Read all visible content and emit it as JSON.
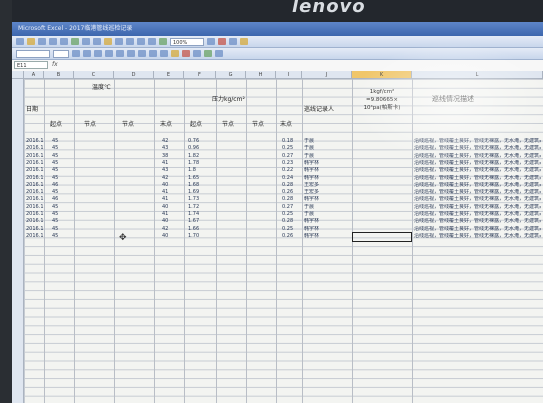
{
  "monitor": {
    "brand": "lenovo"
  },
  "window": {
    "title": "Microsoft Excel - 2017临港管线巡检记录"
  },
  "formula_bar": {
    "cell_ref": "E11",
    "fx": "fx",
    "zoom": "100%"
  },
  "columns": [
    "A",
    "B",
    "C",
    "D",
    "E",
    "F",
    "G",
    "H",
    "I",
    "J",
    "K",
    "L"
  ],
  "header": {
    "date": "日期",
    "temp_group": "温度℃",
    "pressure_group": "压力kg/cm²",
    "start1": "起点",
    "mid1": "节点",
    "mid2": "节点",
    "end1": "末点",
    "start2": "起点",
    "mid3": "节点",
    "mid4": "节点",
    "end2": "末点",
    "inspector": "巡线记录人",
    "conversion": "1kgf/cm² =9.80665× 10⁴pa(帕斯卡)",
    "description": "巡线情况描述"
  },
  "rows": [
    {
      "date": "2016.1.2",
      "t1": "45",
      "t4": "42",
      "p1": "0.76",
      "p4": "0.18",
      "who": "于晨"
    },
    {
      "date": "2016.1.5",
      "t1": "45",
      "t4": "43",
      "p1": "0.96",
      "p4": "0.25",
      "who": "于晨"
    },
    {
      "date": "2016.1.6",
      "t1": "45",
      "t4": "38",
      "p1": "1.82",
      "p4": "0.27",
      "who": "于晨"
    },
    {
      "date": "2016.1.11",
      "t1": "45",
      "t4": "41",
      "p1": "1.78",
      "p4": "0.23",
      "who": "韩宇林"
    },
    {
      "date": "2016.1.12",
      "t1": "45",
      "t4": "43",
      "p1": "1.8",
      "p4": "0.22",
      "who": "韩宇林"
    },
    {
      "date": "2016.1.13",
      "t1": "45",
      "t4": "42",
      "p1": "1.65",
      "p4": "0.24",
      "who": "韩宇林"
    },
    {
      "date": "2016.1.14",
      "t1": "46",
      "t4": "40",
      "p1": "1.68",
      "p4": "0.28",
      "who": "王宏多"
    },
    {
      "date": "2016.1.15",
      "t1": "45",
      "t4": "41",
      "p1": "1.69",
      "p4": "0.26",
      "who": "王宏多"
    },
    {
      "date": "2016.1.17",
      "t1": "46",
      "t4": "41",
      "p1": "1.73",
      "p4": "0.28",
      "who": "韩宇林"
    },
    {
      "date": "2016.1.20",
      "t1": "45",
      "t4": "40",
      "p1": "1.72",
      "p4": "0.27",
      "who": "于晨"
    },
    {
      "date": "2016.1.21",
      "t1": "45",
      "t4": "41",
      "p1": "1.74",
      "p4": "0.25",
      "who": "于晨"
    },
    {
      "date": "2016.1.24",
      "t1": "45",
      "t4": "40",
      "p1": "1.67",
      "p4": "0.28",
      "who": "韩宇林"
    },
    {
      "date": "2016.1.27",
      "t1": "45",
      "t4": "42",
      "p1": "1.66",
      "p4": "0.25",
      "who": "韩宇林"
    },
    {
      "date": "2016.1.29",
      "t1": "45",
      "t4": "40",
      "p1": "1.70",
      "p4": "0.26",
      "who": "韩宇林"
    }
  ],
  "description_text": "沿线巡视，管线覆土良好，管线无裸露，无水淹，无建筑占压"
}
